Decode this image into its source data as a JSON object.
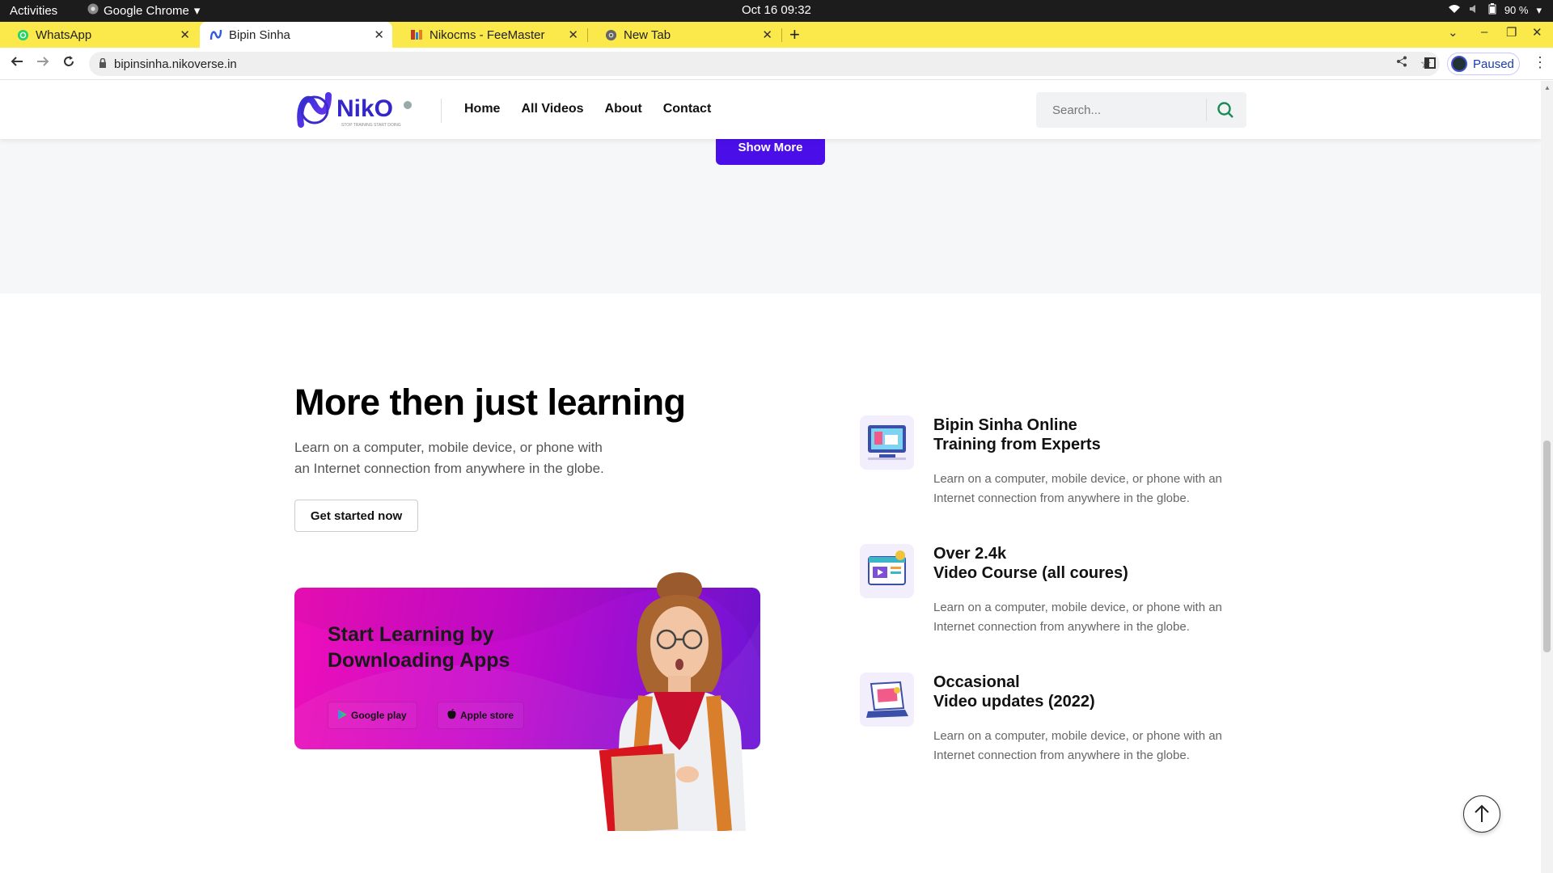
{
  "os": {
    "activities": "Activities",
    "app_name": "Google Chrome",
    "clock": "Oct 16  09:32",
    "battery": "90 %"
  },
  "tabs": [
    {
      "label": "WhatsApp",
      "icon": "whatsapp-icon"
    },
    {
      "label": "Bipin Sinha",
      "icon": "niko-icon"
    },
    {
      "label": "Nikocms - FeeMaster",
      "icon": "feemaster-icon"
    },
    {
      "label": "New Tab",
      "icon": "chrome-icon"
    }
  ],
  "address": {
    "url": "bipinsinha.nikoverse.in"
  },
  "profile": {
    "status": "Paused"
  },
  "site": {
    "logo_text": "NikO",
    "logo_tagline": "STOP TRAINING START DOING",
    "nav": [
      "Home",
      "All Videos",
      "About",
      "Contact"
    ],
    "search_placeholder": "Search..."
  },
  "show_more": "Show More",
  "hero": {
    "title": "More then just learning",
    "lead": "Learn on a computer, mobile device, or phone with an Internet connection from anywhere in the globe.",
    "cta": "Get started now"
  },
  "promo": {
    "title": "Start Learning by Downloading Apps",
    "google_play": "Google play",
    "apple_store": "Apple store"
  },
  "features": [
    {
      "line1": "Bipin Sinha Online",
      "line2": "Training from Experts",
      "desc": "Learn on a computer, mobile device, or phone with an Internet connection from anywhere in the globe."
    },
    {
      "line1": "Over 2.4k",
      "line2": "Video Course (all coures)",
      "desc": "Learn on a computer, mobile device, or phone with an Internet connection from anywhere in the globe."
    },
    {
      "line1": "Occasional",
      "line2": "Video updates (2022)",
      "desc": "Learn on a computer, mobile device, or phone with an Internet connection from anywhere in the globe."
    }
  ],
  "colors": {
    "accent": "#4a0fe8",
    "tabstrip": "#fbe94b",
    "promo_start": "#ee0fb8",
    "promo_end": "#6a14d6"
  }
}
